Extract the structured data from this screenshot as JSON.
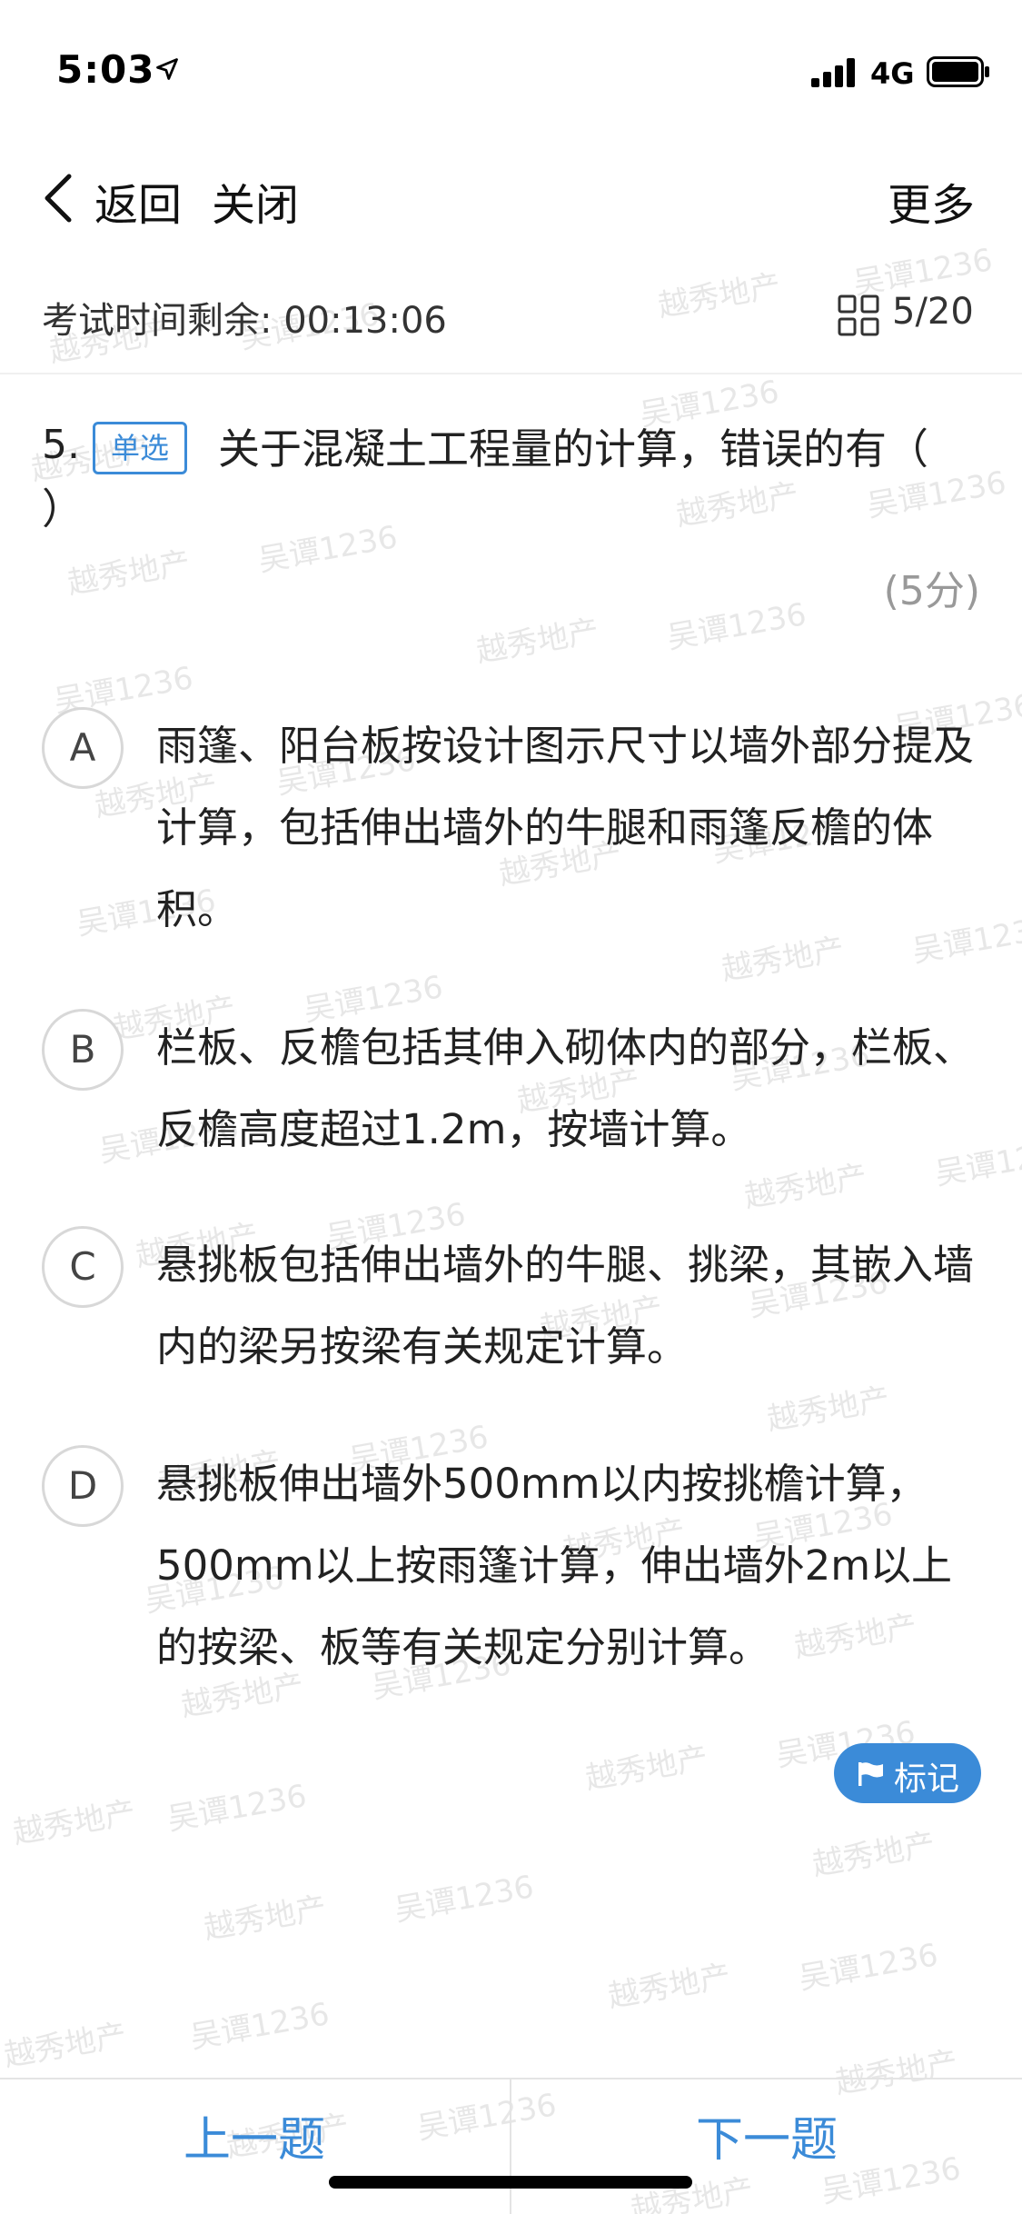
{
  "status_bar": {
    "time": "5:03",
    "network": "4G",
    "location_icon": "location-arrow-icon",
    "signal_icon": "signal-bars-icon",
    "battery_icon": "battery-full-icon"
  },
  "nav": {
    "back_label": "返回",
    "close_label": "关闭",
    "more_label": "更多",
    "back_icon": "chevron-left-icon"
  },
  "exam": {
    "timer": "考试时间剩余: 00:13:06",
    "progress": "5/20",
    "grid_icon": "question-grid-icon"
  },
  "question": {
    "number": "5.",
    "type_badge": "单选",
    "text": "关于混凝土工程量的计算，错误的有（",
    "text_cont": "）",
    "score": "(5分)"
  },
  "options": [
    {
      "letter": "A",
      "text": "雨篷、阳台板按设计图示尺寸以墙外部分提及计算，包括伸出墙外的牛腿和雨篷反檐的体积。"
    },
    {
      "letter": "B",
      "text": "栏板、反檐包括其伸入砌体内的部分，栏板、反檐高度超过1.2m，按墙计算。"
    },
    {
      "letter": "C",
      "text": "悬挑板包括伸出墙外的牛腿、挑梁，其嵌入墙内的梁另按梁有关规定计算。"
    },
    {
      "letter": "D",
      "text": "悬挑板伸出墙外500mm以内按挑檐计算，500mm以上按雨篷计算，伸出墙外2m以上的按梁、板等有关规定分别计算。"
    }
  ],
  "mark": {
    "label": "标记",
    "icon": "flag-icon"
  },
  "bottom_nav": {
    "prev_label": "上一题",
    "next_label": "下一题"
  },
  "watermark": {
    "company": "越秀地产",
    "user": "吴谭1236"
  },
  "colors": {
    "accent": "#3b8bd8",
    "text": "#222222",
    "muted": "#999999",
    "circle_border": "#d8d8d8"
  }
}
